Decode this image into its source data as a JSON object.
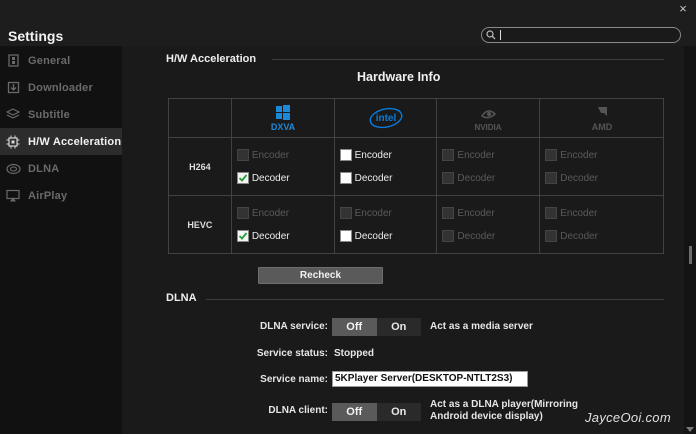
{
  "window": {
    "close_glyph": "×"
  },
  "header": {
    "title": "Settings",
    "search": {
      "placeholder": "",
      "value": ""
    }
  },
  "sidebar": {
    "items": [
      {
        "label": "General",
        "icon": "general-icon",
        "active": false
      },
      {
        "label": "Downloader",
        "icon": "download-icon",
        "active": false
      },
      {
        "label": "Subtitle",
        "icon": "layers-icon",
        "active": false
      },
      {
        "label": "H/W Acceleration",
        "icon": "chip-icon",
        "active": true
      },
      {
        "label": "DLNA",
        "icon": "dlna-icon",
        "active": false
      },
      {
        "label": "AirPlay",
        "icon": "airplay-icon",
        "active": false
      }
    ]
  },
  "hw_section": {
    "heading": "H/W Acceleration",
    "table_title": "Hardware Info",
    "vendors": [
      {
        "name": "DXVA",
        "icon": "windows-logo-icon",
        "active": true
      },
      {
        "name": "intel",
        "icon": "intel-logo-icon",
        "active": true
      },
      {
        "name": "NVIDIA",
        "icon": "nvidia-logo-icon",
        "active": false
      },
      {
        "name": "AMD",
        "icon": "amd-logo-icon",
        "active": false
      }
    ],
    "rows": [
      {
        "codec": "H264",
        "encoder_label": "Encoder",
        "decoder_label": "Decoder",
        "encoder": [
          {
            "enabled": false,
            "checked": false
          },
          {
            "enabled": true,
            "checked": false
          },
          {
            "enabled": false,
            "checked": false
          },
          {
            "enabled": false,
            "checked": false
          }
        ],
        "decoder": [
          {
            "enabled": true,
            "checked": true
          },
          {
            "enabled": true,
            "checked": false
          },
          {
            "enabled": false,
            "checked": false
          },
          {
            "enabled": false,
            "checked": false
          }
        ]
      },
      {
        "codec": "HEVC",
        "encoder_label": "Encoder",
        "decoder_label": "Decoder",
        "encoder": [
          {
            "enabled": false,
            "checked": false
          },
          {
            "enabled": false,
            "checked": false
          },
          {
            "enabled": false,
            "checked": false
          },
          {
            "enabled": false,
            "checked": false
          }
        ],
        "decoder": [
          {
            "enabled": true,
            "checked": true
          },
          {
            "enabled": true,
            "checked": false
          },
          {
            "enabled": false,
            "checked": false
          },
          {
            "enabled": false,
            "checked": false
          }
        ]
      }
    ],
    "recheck_label": "Recheck"
  },
  "dlna_section": {
    "heading": "DLNA",
    "service": {
      "label": "DLNA service:",
      "off": "Off",
      "on": "On",
      "selected": "Off",
      "desc": "Act as a media server"
    },
    "status": {
      "label": "Service status:",
      "value": "Stopped"
    },
    "name": {
      "label": "Service name:",
      "value": "5KPlayer Server(DESKTOP-NTLT2S3)"
    },
    "client": {
      "label": "DLNA client:",
      "off": "Off",
      "on": "On",
      "selected": "Off",
      "desc_line1": "Act as a DLNA player(Mirroring",
      "desc_line2": "Android device display)"
    }
  },
  "watermark": "JayceOoi.com",
  "colors": {
    "background": "#1a1a1a",
    "sidebar": "#111111",
    "active_item": "#2c2c2c",
    "toggle_selected": "#5a5a5a",
    "intel_blue": "#0a7bd8",
    "windows_blue": "#1e88d8"
  }
}
